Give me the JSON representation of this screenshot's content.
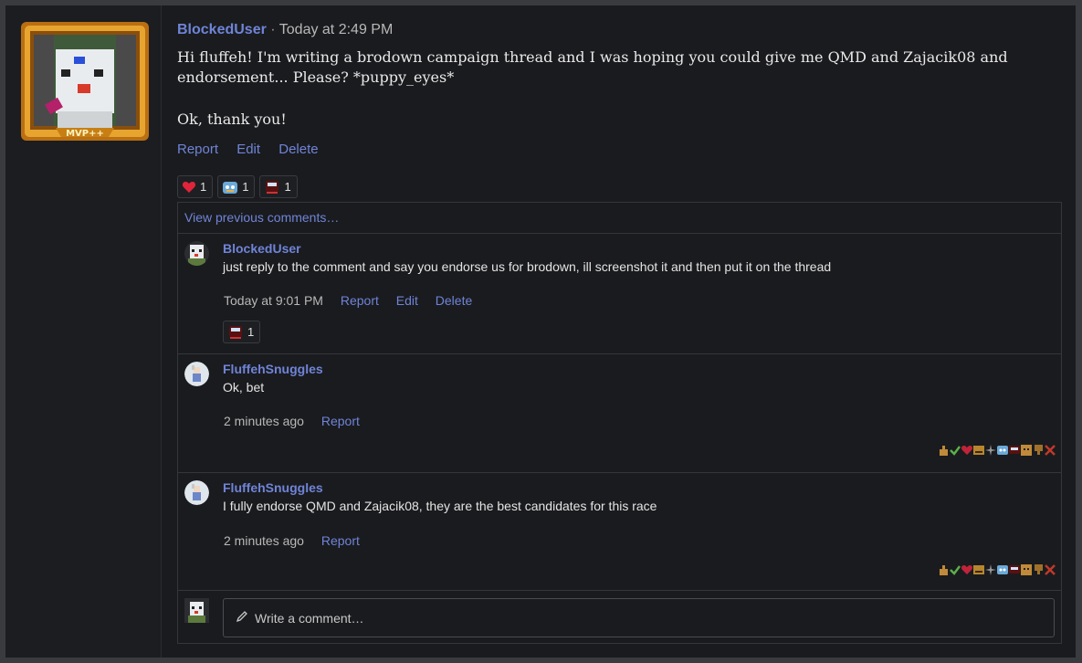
{
  "post": {
    "author": "BlockedUser",
    "separator": "·",
    "time": "Today at 2:49 PM",
    "body_line1": "Hi fluffeh! I'm writing a brodown campaign thread and I was hoping you could give me QMD and Zajacik08 and",
    "body_line2": "endorsement... Please? *puppy_eyes*",
    "body_line3": "Ok, thank you!",
    "badge_text": "MVP++",
    "actions": {
      "report": "Report",
      "edit": "Edit",
      "delete": "Delete"
    },
    "reactions": [
      {
        "icon": "heart-icon",
        "count": "1"
      },
      {
        "icon": "robot-face-icon",
        "count": "1"
      },
      {
        "icon": "train-icon",
        "count": "1"
      }
    ]
  },
  "comments": {
    "view_previous": "View previous comments…",
    "items": [
      {
        "author": "BlockedUser",
        "text": "just reply to the comment and say you endorse us for brodown, ill screenshot it and then put it on the thread",
        "time": "Today at 9:01 PM",
        "report": "Report",
        "edit": "Edit",
        "delete": "Delete",
        "reaction_count": "1"
      },
      {
        "author": "FluffehSnuggles",
        "text": "Ok, bet",
        "time": "2 minutes ago",
        "report": "Report"
      },
      {
        "author": "FluffehSnuggles",
        "text": "I fully endorse QMD and Zajacik08, they are the best candidates for this race",
        "time": "2 minutes ago",
        "report": "Report"
      }
    ],
    "write_placeholder": "Write a comment…"
  },
  "colors": {
    "link": "#6f84d8",
    "background": "#1a1b1e",
    "border": "#34363b"
  }
}
